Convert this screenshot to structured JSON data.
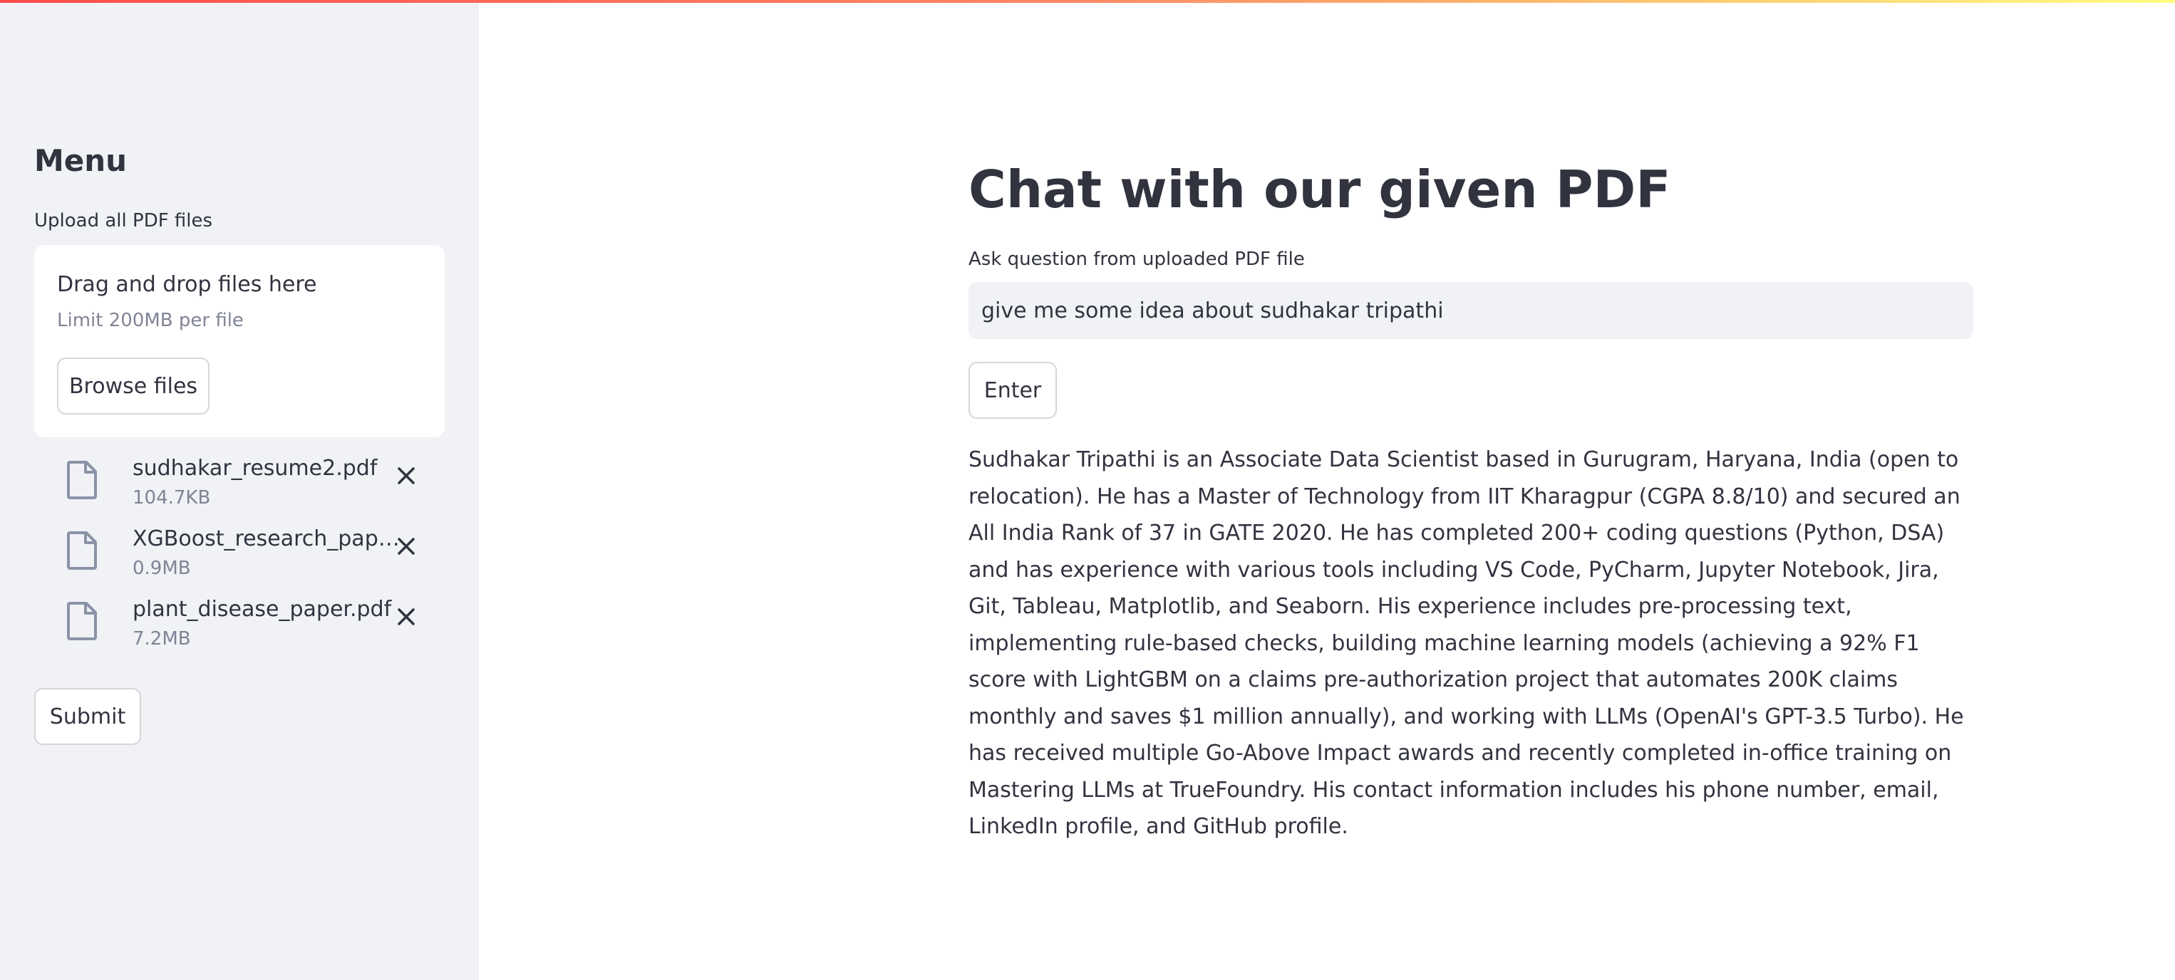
{
  "sidebar": {
    "title": "Menu",
    "upload_label": "Upload all PDF files",
    "dropzone": {
      "main_text": "Drag and drop files here",
      "limit_text": "Limit 200MB per file",
      "browse_label": "Browse files"
    },
    "files": [
      {
        "name": "sudhakar_resume2.pdf",
        "size": "104.7KB"
      },
      {
        "name": "XGBoost_research_paper.pdf",
        "size": "0.9MB"
      },
      {
        "name": "plant_disease_paper.pdf",
        "size": "7.2MB"
      }
    ],
    "submit_label": "Submit"
  },
  "main": {
    "title": "Chat with our given PDF",
    "input_label": "Ask question from uploaded PDF file",
    "input_value": "give me some idea about sudhakar tripathi",
    "enter_label": "Enter",
    "answer": "Sudhakar Tripathi is an Associate Data Scientist based in Gurugram, Haryana, India (open to relocation). He has a Master of Technology from IIT Kharagpur (CGPA 8.8/10) and secured an All India Rank of 37 in GATE 2020. He has completed 200+ coding questions (Python, DSA) and has experience with various tools including VS Code, PyCharm, Jupyter Notebook, Jira, Git, Tableau, Matplotlib, and Seaborn. His experience includes pre-processing text, implementing rule-based checks, building machine learning models (achieving a 92% F1 score with LightGBM on a claims pre-authorization project that automates 200K claims monthly and saves $1 million annually), and working with LLMs (OpenAI's GPT-3.5 Turbo). He has received multiple Go-Above Impact awards and recently completed in-office training on Mastering LLMs at TrueFoundry. His contact information includes his phone number, email, LinkedIn profile, and GitHub profile."
  },
  "theme": {
    "accent_gradient": [
      "#ff4b4b",
      "#fffd80"
    ],
    "sidebar_bg": "#f0f2f6",
    "text_color": "#31333f",
    "muted_text": "#808495"
  }
}
